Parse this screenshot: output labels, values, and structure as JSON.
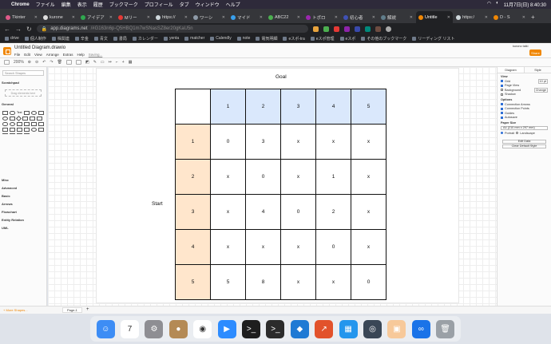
{
  "menubar": {
    "app": "Chrome",
    "items": [
      "ファイル",
      "編集",
      "表示",
      "履歴",
      "ブックマーク",
      "プロフィール",
      "タブ",
      "ウィンドウ",
      "ヘルプ"
    ],
    "clock": "11月7日(日) 8:40:30"
  },
  "tabs": [
    {
      "title": "Tkinter",
      "color": "#e05a8a"
    },
    {
      "title": "kurone",
      "color": "#dddddd"
    },
    {
      "title": "アイデア",
      "color": "#2fa84f"
    },
    {
      "title": "Mリー",
      "color": "#e53935"
    },
    {
      "title": "https://",
      "color": "#cfd8dc"
    },
    {
      "title": "ワーシ",
      "color": "#8e9aa8"
    },
    {
      "title": "マイド",
      "color": "#39a0ed"
    },
    {
      "title": "ABC22",
      "color": "#4caf50"
    },
    {
      "title": "トポロ",
      "color": "#9c27b0"
    },
    {
      "title": "初心者",
      "color": "#3f51b5"
    },
    {
      "title": "解説",
      "color": "#607d8b"
    },
    {
      "title": "Untitle",
      "color": "#f08705"
    },
    {
      "title": "https:/",
      "color": "#cfd8dc"
    },
    {
      "title": "D - S",
      "color": "#f08705"
    }
  ],
  "address": {
    "host": "app.diagrams.net",
    "rest": "/#G163n6p-Q5HBQ1m7wSNasSZ8er20gKaU5n"
  },
  "bookmarks": [
    "drive",
    "個人制作",
    "株関連",
    "辛金",
    "青文",
    "書局",
    "カレンダー",
    "yenta",
    "matcher",
    "Calendly",
    "note",
    "電気明細",
    "eスポ-tra",
    "eスポ管理",
    "eスポ",
    "その他のブックマーク",
    "リーディング リスト"
  ],
  "app": {
    "doc_title": "Untitled Diagram.drawio",
    "menus": [
      "File",
      "Edit",
      "View",
      "Arrange",
      "Extras",
      "Help"
    ],
    "saving": "Saving...",
    "share": "Share",
    "user": "kurono taiki"
  },
  "toolbar": {
    "zoom": "200%"
  },
  "sidebar": {
    "search_placeholder": "Search Shapes",
    "scratchpad": "Scratchpad",
    "drag_hint": "Drag elements here",
    "sections": [
      "General",
      "Misc",
      "Advanced",
      "Basic",
      "Arrows",
      "Flowchart",
      "Entity Relation",
      "UML"
    ]
  },
  "diagram": {
    "goal": "Goal",
    "start": "Start",
    "header": [
      "",
      "1",
      "2",
      "3",
      "4",
      "5"
    ],
    "rows": [
      {
        "label": "1",
        "cells": [
          "0",
          "3",
          "x",
          "x",
          "x"
        ]
      },
      {
        "label": "2",
        "cells": [
          "x",
          "0",
          "x",
          "1",
          "x"
        ]
      },
      {
        "label": "3",
        "cells": [
          "x",
          "4",
          "0",
          "2",
          "x"
        ]
      },
      {
        "label": "4",
        "cells": [
          "x",
          "x",
          "x",
          "0",
          "x"
        ]
      },
      {
        "label": "5",
        "cells": [
          "5",
          "8",
          "x",
          "x",
          "0"
        ]
      }
    ]
  },
  "format": {
    "tab1": "Diagram",
    "tab2": "Style",
    "view": "View",
    "grid": "Grid",
    "grid_size": "10 pt",
    "page_view": "Page View",
    "background": "Background",
    "change": "Change",
    "shadow": "Shadow",
    "options": "Options",
    "opt1": "Connection Arrows",
    "opt2": "Connection Points",
    "opt3": "Guides",
    "opt4": "Autosave",
    "paper_size": "Paper Size",
    "paper": "A4 (210 mm x 297 mm)",
    "portrait": "Portrait",
    "landscape": "Landscape",
    "edit_data": "Edit Data",
    "clear_style": "Clear Default Style"
  },
  "bottom": {
    "more": "+ More Shapes...",
    "page": "Page-1"
  },
  "dock": [
    {
      "name": "finder",
      "color": "#3d8df5",
      "glyph": "☺"
    },
    {
      "name": "calendar",
      "color": "#ffffff",
      "glyph": "7"
    },
    {
      "name": "settings",
      "color": "#8e8e93",
      "glyph": "⚙"
    },
    {
      "name": "contacts",
      "color": "#b48a55",
      "glyph": "●"
    },
    {
      "name": "chrome",
      "color": "#ffffff",
      "glyph": "◉"
    },
    {
      "name": "zoom",
      "color": "#2d8cff",
      "glyph": "▶"
    },
    {
      "name": "terminal",
      "color": "#1e1e1e",
      "glyph": ">_"
    },
    {
      "name": "terminal2",
      "color": "#2b2b2b",
      "glyph": ">_"
    },
    {
      "name": "vscode",
      "color": "#1f7ad4",
      "glyph": "◆"
    },
    {
      "name": "git",
      "color": "#e2522b",
      "glyph": "↗"
    },
    {
      "name": "docker",
      "color": "#2496ed",
      "glyph": "▦"
    },
    {
      "name": "quicktime",
      "color": "#3a4756",
      "glyph": "◎"
    },
    {
      "name": "preview",
      "color": "#f7c99a",
      "glyph": "▣"
    },
    {
      "name": "infinity",
      "color": "#1a73e8",
      "glyph": "∞"
    },
    {
      "name": "trash",
      "color": "#9aa0a6",
      "glyph": "🗑"
    }
  ]
}
